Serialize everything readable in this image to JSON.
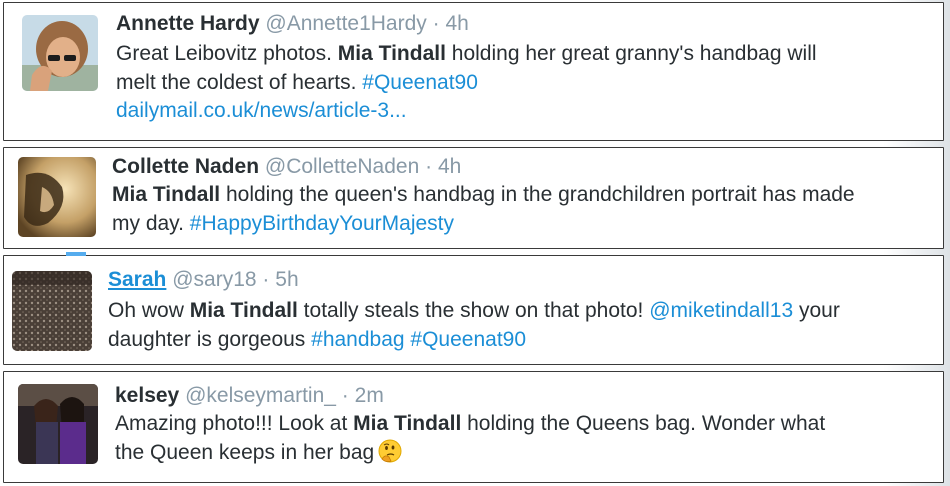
{
  "tweets": [
    {
      "name": "Annette Hardy",
      "handle": "@Annette1Hardy",
      "sep": "·",
      "time": "4h",
      "line1_a": "Great Leibovitz photos. ",
      "line1_b": "Mia Tindall",
      "line1_c": " holding her great granny's handbag will",
      "line2_a": "melt the coldest of hearts. ",
      "line2_tag": "#Queenat90",
      "line3_link": "dailymail.co.uk/news/article-3..."
    },
    {
      "name": "Collette Naden",
      "handle": "@ColletteNaden",
      "sep": "·",
      "time": "4h",
      "line1_b": "Mia Tindall",
      "line1_c": " holding the queen's handbag in the grandchildren portrait has made",
      "line2_a": "my day. ",
      "line2_tag": "#HappyBirthdayYourMajesty"
    },
    {
      "name": "Sarah",
      "handle": "@sary18",
      "sep": "·",
      "time": "5h",
      "line1_a": "Oh wow ",
      "line1_b": "Mia Tindall",
      "line1_c": " totally steals the show on that photo! ",
      "line1_mention": "@miketindall13",
      "line1_d": " your",
      "line2_a": "daughter is gorgeous ",
      "line2_tag1": "#handbag",
      "line2_sp": " ",
      "line2_tag2": "#Queenat90"
    },
    {
      "name": "kelsey",
      "handle": "@kelseymartin_",
      "sep": "·",
      "time": "2m",
      "line1_a": "Amazing photo!!! Look at ",
      "line1_b": "Mia Tindall",
      "line1_c": " holding the Queens bag. Wonder what",
      "line2_a": "the Queen keeps in her bag",
      "emoji": "thinking-face-icon"
    }
  ],
  "colors": {
    "name": "#292f33",
    "meta": "#8899a6",
    "link": "#1b8ed6",
    "border": "#3a3a3a"
  }
}
